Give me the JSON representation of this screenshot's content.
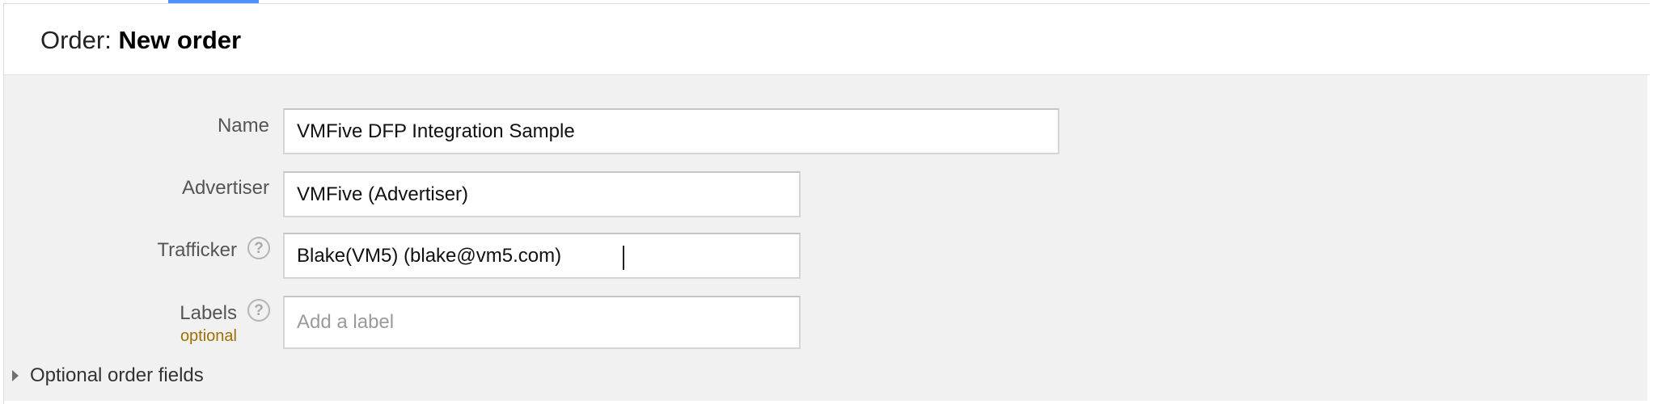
{
  "header": {
    "title_prefix": "Order:",
    "title_value": "New order"
  },
  "form": {
    "name": {
      "label": "Name",
      "value": "VMFive DFP Integration Sample"
    },
    "advertiser": {
      "label": "Advertiser",
      "value": "VMFive (Advertiser)"
    },
    "trafficker": {
      "label": "Trafficker",
      "value": "Blake(VM5) (blake@vm5.com)",
      "help_icon": "question-mark-circle-icon"
    },
    "labels": {
      "label": "Labels",
      "sublabel": "optional",
      "placeholder": "Add a label",
      "value": "",
      "help_icon": "question-mark-circle-icon"
    }
  },
  "optional_fields": {
    "label": "Optional order fields",
    "icon": "triangle-right-icon",
    "expanded": false
  },
  "colors": {
    "tab_indicator": "#4d90fe",
    "form_background": "#f1f1f1",
    "optional_text": "#a06f00"
  }
}
